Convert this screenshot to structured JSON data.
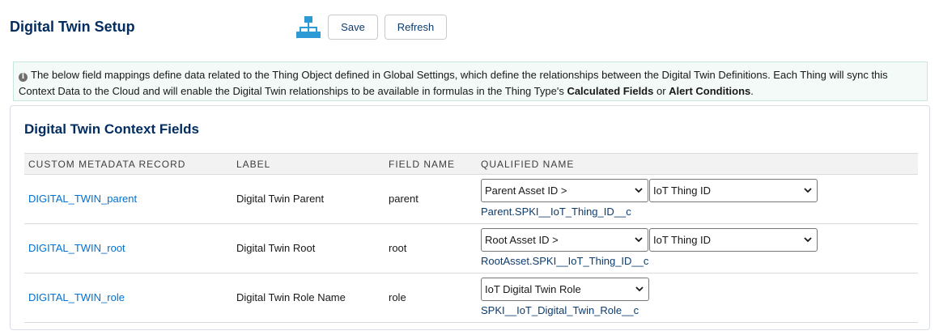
{
  "header": {
    "title": "Digital Twin Setup",
    "icon": "hierarchy-icon",
    "save_label": "Save",
    "refresh_label": "Refresh"
  },
  "info": {
    "text_1": "The below field mappings define data related to the Thing Object defined in Global Settings, which define the relationships between the Digital Twin Definitions. Each Thing will sync this Context Data to the Cloud and will enable the Digital Twin relationships to be available in formulas in the Thing Type's ",
    "bold_1": "Calculated Fields",
    "text_2": " or ",
    "bold_2": "Alert Conditions",
    "text_3": "."
  },
  "card": {
    "title": "Digital Twin Context Fields",
    "columns": [
      "CUSTOM METADATA RECORD",
      "LABEL",
      "FIELD NAME",
      "QUALIFIED NAME"
    ],
    "rows": [
      {
        "record": "DIGITAL_TWIN_parent",
        "label": "Digital Twin Parent",
        "field": "parent",
        "select1": "Parent Asset ID >",
        "select2": "IoT Thing ID",
        "qualified": "Parent.SPKI__IoT_Thing_ID__c"
      },
      {
        "record": "DIGITAL_TWIN_root",
        "label": "Digital Twin Root",
        "field": "root",
        "select1": "Root Asset ID >",
        "select2": "IoT Thing ID",
        "qualified": "RootAsset.SPKI__IoT_Thing_ID__c"
      },
      {
        "record": "DIGITAL_TWIN_role",
        "label": "Digital Twin Role Name",
        "field": "role",
        "select1": "IoT Digital Twin Role",
        "qualified": "SPKI__IoT_Digital_Twin_Role__c"
      }
    ]
  },
  "colors": {
    "title": "#032d60",
    "link": "#0070d2",
    "icon": "#2d9ad6",
    "info_bg": "#f3faf8"
  }
}
